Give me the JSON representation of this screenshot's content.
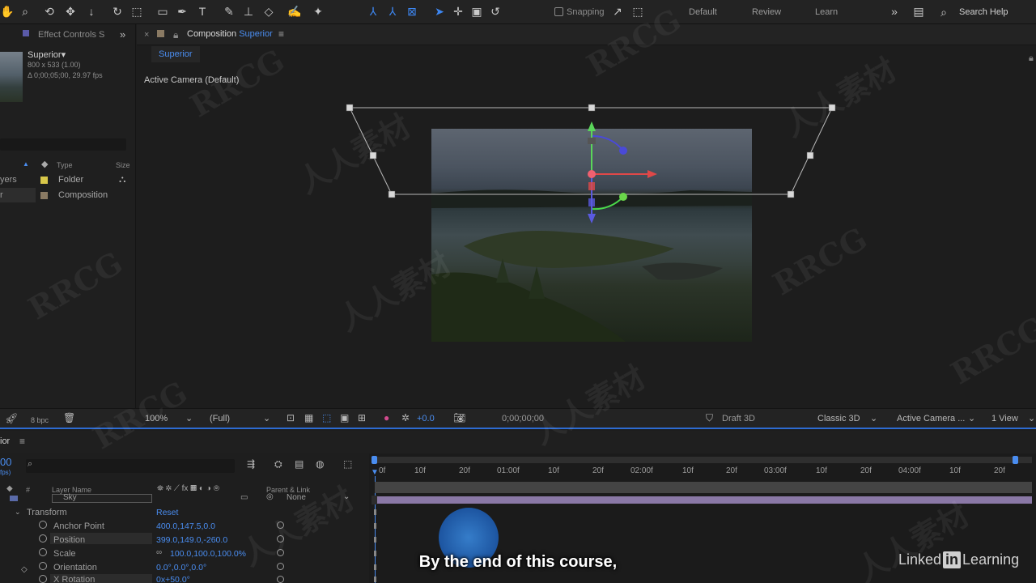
{
  "toolbar": {
    "snapping_label": "Snapping",
    "workspaces": [
      "Default",
      "Review",
      "Learn"
    ],
    "search_label": "Search Help"
  },
  "project": {
    "effect_controls_tab": "Effect Controls S",
    "item_name": "Superior▾",
    "item_dims": "800 x 533 (1.00)",
    "item_duration": "Δ 0;00;05;00, 29.97 fps",
    "col_type": "Type",
    "col_size": "Size",
    "rows": [
      {
        "name": "yers",
        "type": "Folder",
        "color": "#d9c84a"
      },
      {
        "name": "r",
        "type": "Composition",
        "color": "#8a7a63"
      }
    ]
  },
  "composition": {
    "tab_prefix": "Composition",
    "tab_name": "Superior",
    "sub_tab": "Superior",
    "camera_label": "Active Camera (Default)"
  },
  "viewer_bar": {
    "bpc": "8 bpc",
    "zoom": "100%",
    "resolution": "(Full)",
    "exposure": "+0.0",
    "timecode": "0;00;00;00",
    "draft": "Draft 3D",
    "renderer": "Classic 3D",
    "camera": "Active Camera ...",
    "views": "1 View"
  },
  "timeline": {
    "comp_name": "ior",
    "current_time": "00",
    "current_time_sub": "fps)",
    "col_layer_name": "Layer Name",
    "col_parent": "Parent & Link",
    "layer_name": "Sky",
    "parent_value": "None",
    "transform_label": "Transform",
    "reset_label": "Reset",
    "properties": [
      {
        "name": "Anchor Point",
        "value": "400.0,147.5,0.0"
      },
      {
        "name": "Position",
        "value": "399.0,149.0,-260.0"
      },
      {
        "name": "Scale",
        "value": "100.0,100.0,100.0%"
      },
      {
        "name": "Orientation",
        "value": "0.0°,0.0°,0.0°"
      },
      {
        "name": "X Rotation",
        "value": "0x+50.0°"
      }
    ],
    "ruler_ticks": [
      "0f",
      "10f",
      "20f",
      "01:00f",
      "10f",
      "20f",
      "02:00f",
      "10f",
      "20f",
      "03:00f",
      "10f",
      "20f",
      "04:00f",
      "10f",
      "20f"
    ]
  },
  "subtitle": "By the end of this course,",
  "brand": {
    "pre": "Linked",
    "box": "in",
    "post": "Learning"
  },
  "watermarks": [
    "RRCG",
    "人人素材",
    "RRCG",
    "人人素材",
    "RRCG",
    "人人素材",
    "RRCG",
    "人人素材",
    "RRCG",
    "人人素材",
    "RRCG",
    "人人素材"
  ],
  "colors": {
    "accent": "#4a8df0",
    "layer_bar": "#8a78a6",
    "background": "#1d1d1d"
  }
}
